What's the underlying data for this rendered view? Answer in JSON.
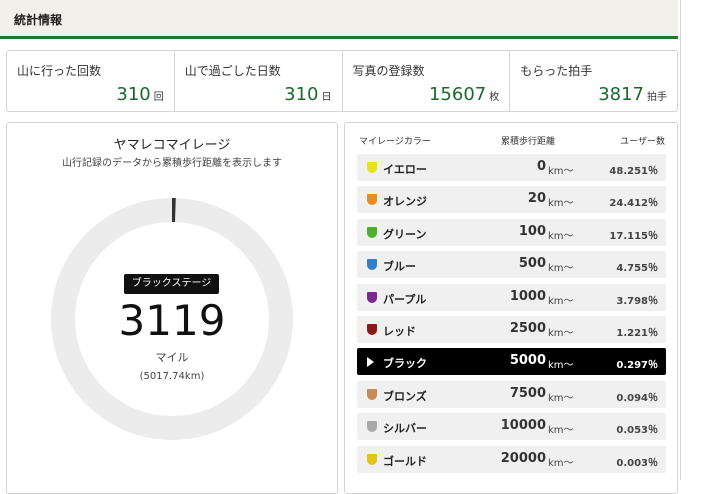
{
  "header": {
    "title": "統計情報"
  },
  "stats": [
    {
      "label": "山に行った回数",
      "value": "310",
      "unit": "回"
    },
    {
      "label": "山で過ごした日数",
      "value": "310",
      "unit": "日"
    },
    {
      "label": "写真の登録数",
      "value": "15607",
      "unit": "枚"
    },
    {
      "label": "もらった拍手",
      "value": "3817",
      "unit": "拍手"
    }
  ],
  "mileage": {
    "title": "ヤマレコマイレージ",
    "subtitle": "山行記録のデータから累積歩行距離を表示します",
    "stage": "ブラックステージ",
    "value": "3119",
    "unit": "マイル",
    "km": "(5017.74km)",
    "progress": 0.005,
    "colors": {
      "ring_track": "#ececec",
      "ring_fill": "#333333"
    }
  },
  "table": {
    "headers": {
      "color": "マイレージカラー",
      "distance": "累積歩行距離",
      "users": "ユーザー数"
    },
    "km_suffix": "km〜",
    "rows": [
      {
        "name": "イエロー",
        "distance": "0",
        "users": "48.251％",
        "color": "#e8e21c",
        "current": false
      },
      {
        "name": "オレンジ",
        "distance": "20",
        "users": "24.412％",
        "color": "#ef8a17",
        "current": false
      },
      {
        "name": "グリーン",
        "distance": "100",
        "users": "17.115％",
        "color": "#4caf2e",
        "current": false
      },
      {
        "name": "ブルー",
        "distance": "500",
        "users": "4.755％",
        "color": "#2f7fc9",
        "current": false
      },
      {
        "name": "パープル",
        "distance": "1000",
        "users": "3.798％",
        "color": "#7a2a8c",
        "current": false
      },
      {
        "name": "レッド",
        "distance": "2500",
        "users": "1.221％",
        "color": "#8a1a1a",
        "current": false
      },
      {
        "name": "ブラック",
        "distance": "5000",
        "users": "0.297％",
        "color": "#000000",
        "current": true
      },
      {
        "name": "ブロンズ",
        "distance": "7500",
        "users": "0.094％",
        "color": "#c98a5a",
        "current": false
      },
      {
        "name": "シルバー",
        "distance": "10000",
        "users": "0.053％",
        "color": "#a9a9a9",
        "current": false
      },
      {
        "name": "ゴールド",
        "distance": "20000",
        "users": "0.003％",
        "color": "#e3c21a",
        "current": false
      }
    ]
  }
}
